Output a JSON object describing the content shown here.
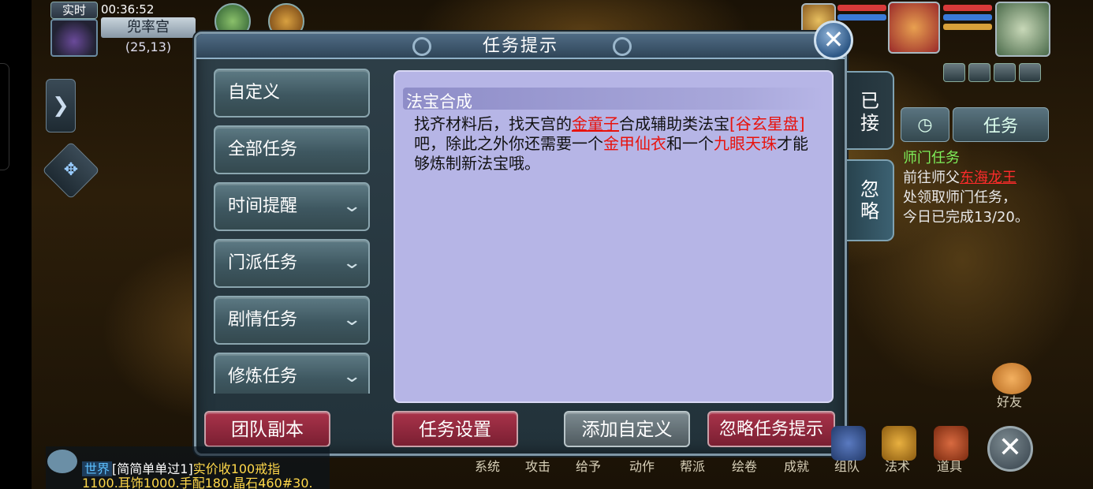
{
  "status": {
    "time_label": "实时",
    "time": "00:36:52",
    "map_name": "兜率宫",
    "coords": "(25,13)"
  },
  "dialog": {
    "title": "任务提示",
    "categories": [
      {
        "label": "自定义",
        "expandable": false
      },
      {
        "label": "全部任务",
        "expandable": false
      },
      {
        "label": "时间提醒",
        "expandable": true
      },
      {
        "label": "门派任务",
        "expandable": true
      },
      {
        "label": "剧情任务",
        "expandable": true
      },
      {
        "label": "修炼任务",
        "expandable": true
      }
    ],
    "detail": {
      "title": "法宝合成",
      "seg1": "找齐材料后，找天宫的",
      "npc": "金童子",
      "seg2": "合成辅助类法宝",
      "item1": "[谷玄星盘]",
      "seg3": "吧，除此之外你还需要一个",
      "item2": "金甲仙衣",
      "seg4": "和一个",
      "item3": "九眼天珠",
      "seg5": "才能够炼制新法宝哦。"
    },
    "side_tabs": {
      "accepted": "已接",
      "ignored": "忽略"
    },
    "buttons": {
      "team_dungeon": "团队副本",
      "task_settings": "任务设置",
      "add_custom": "添加自定义",
      "ignore_hint": "忽略任务提示"
    },
    "chevron": "❯"
  },
  "tracker": {
    "tab_task": "任务",
    "title": "师门任务",
    "line1": "前往师父",
    "npc": "东海龙王",
    "line2": "处领取师门任务，",
    "line3": "今日已完成13/20。"
  },
  "chat": {
    "channel": "世界",
    "player": "[简简单单过1]",
    "message1": "实价收100戒指",
    "message2": "1100.耳饰1000.手配180.晶石460#30."
  },
  "menu": [
    "系统",
    "攻击",
    "给予",
    "动作",
    "帮派",
    "绘卷",
    "成就",
    "组队",
    "法术",
    "道具"
  ],
  "friends_label": "好友",
  "colors": {
    "highlight": "#e8120c",
    "tracker_title": "#7ef05a",
    "detail_bg": "#b6b5e6",
    "red_button": "#a9334a"
  }
}
